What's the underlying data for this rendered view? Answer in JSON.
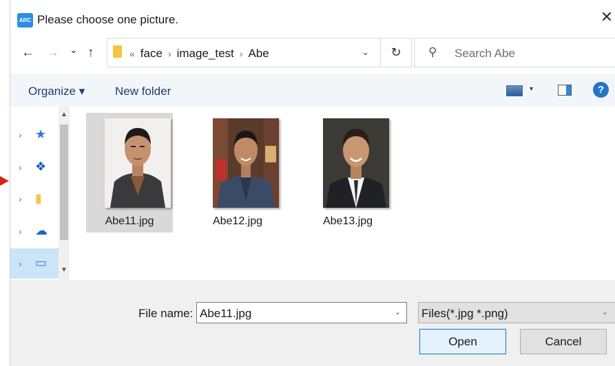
{
  "window": {
    "logo_text": "ARC",
    "title": "Please choose one picture.",
    "close_glyph": "✕"
  },
  "nav": {
    "back_glyph": "←",
    "forward_glyph": "→",
    "recent_glyph": "⌄",
    "up_glyph": "↑",
    "breadcrumb_overflow": "«",
    "breadcrumbs": [
      "face",
      "image_test",
      "Abe"
    ],
    "separator": "›",
    "refresh_glyph": "↻",
    "search_placeholder": "Search Abe"
  },
  "toolbar": {
    "organize_label": "Organize ▾",
    "new_folder_label": "New folder",
    "view_dropdown_glyph": "▾",
    "help_glyph": "?"
  },
  "sidebar": {
    "items": [
      {
        "icon": "quick-access-icon",
        "glyph": "★",
        "color": "#2b7cd3"
      },
      {
        "icon": "dropbox-icon",
        "glyph": "❖",
        "color": "#0f5fbf"
      },
      {
        "icon": "folder-icon",
        "glyph": "▮",
        "color": "#f4c542"
      },
      {
        "icon": "onedrive-icon",
        "glyph": "☁",
        "color": "#0f6cc4"
      },
      {
        "icon": "this-pc-icon",
        "glyph": "▭",
        "color": "#3d7cc9"
      }
    ],
    "selected_index": 4
  },
  "files": [
    {
      "name": "Abe11.jpg",
      "selected": true
    },
    {
      "name": "Abe12.jpg",
      "selected": false
    },
    {
      "name": "Abe13.jpg",
      "selected": false
    }
  ],
  "bottom": {
    "file_name_label": "File name:",
    "file_name_value": "Abe11.jpg",
    "file_type_value": "Files(*.jpg *.png)",
    "open_label": "Open",
    "cancel_label": "Cancel",
    "dropdown_glyph": "⌄"
  },
  "colors": {
    "accent": "#0078d7",
    "arrow": "#d9241b"
  }
}
